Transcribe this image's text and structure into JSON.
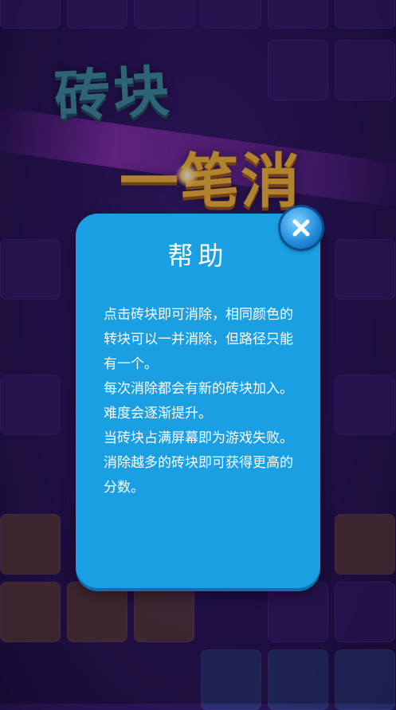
{
  "title": {
    "line1": "砖块",
    "line2": "一笔消"
  },
  "dialog": {
    "title": "帮助",
    "paragraphs": [
      "点击砖块即可消除，相同颜色的转块可以一并消除，但路径只能有一个。",
      "每次消除都会有新的砖块加入。",
      "难度会逐渐提升。",
      "当砖块占满屏幕即为游戏失败。",
      "消除越多的砖块即可获得更高的分数。"
    ],
    "close_icon": "close-icon"
  },
  "colors": {
    "dialog_bg": "#1a9fe3",
    "background": "#2a1558",
    "title_teal": "#3c8a99",
    "title_orange": "#f2b535"
  }
}
